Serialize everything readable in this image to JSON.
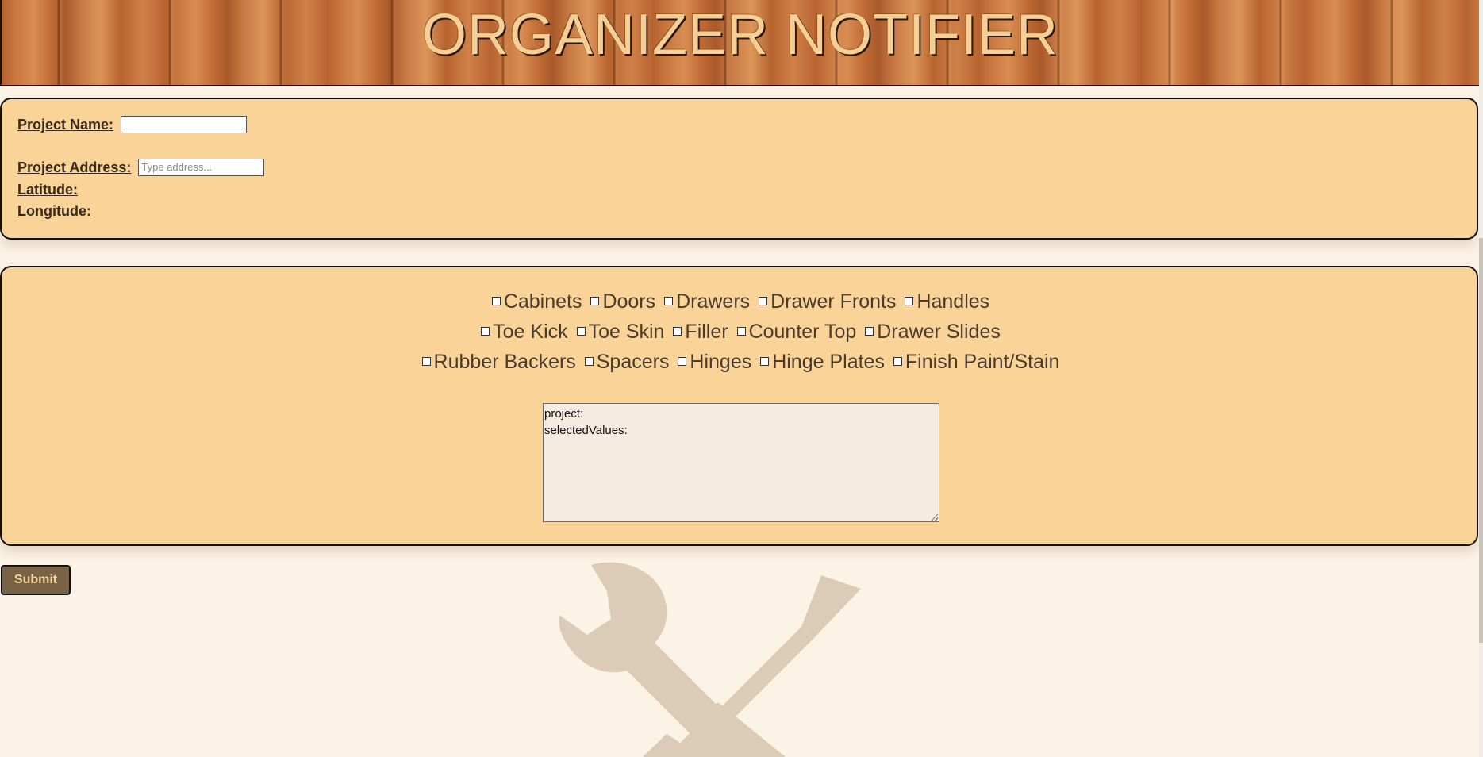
{
  "header": {
    "title": "ORGANIZER NOTIFIER"
  },
  "project": {
    "name_label": "Project Name:",
    "name_value": "",
    "address_label": "Project Address:",
    "address_placeholder": "Type address...",
    "latitude_label": "Latitude:",
    "longitude_label": "Longitude:"
  },
  "materials": {
    "lines": [
      [
        "Cabinets",
        "Doors",
        "Drawers",
        "Drawer Fronts",
        "Handles"
      ],
      [
        "Toe Kick",
        "Toe Skin",
        "Filler",
        "Counter Top",
        "Drawer Slides"
      ],
      [
        "Rubber Backers",
        "Spacers",
        "Hinges",
        "Hinge Plates",
        "Finish Paint/Stain"
      ]
    ],
    "checked": []
  },
  "output": {
    "line1": "project:",
    "line2": "selectedValues:"
  },
  "actions": {
    "submit_label": "Submit"
  },
  "icons": {
    "background": "wrench-screwdriver-icon"
  },
  "colors": {
    "panel": "#fad399",
    "page_background": "#fcf3e7",
    "title": "#f5cf94",
    "submit_bg": "#7a6246",
    "submit_text": "#f6d49b"
  }
}
